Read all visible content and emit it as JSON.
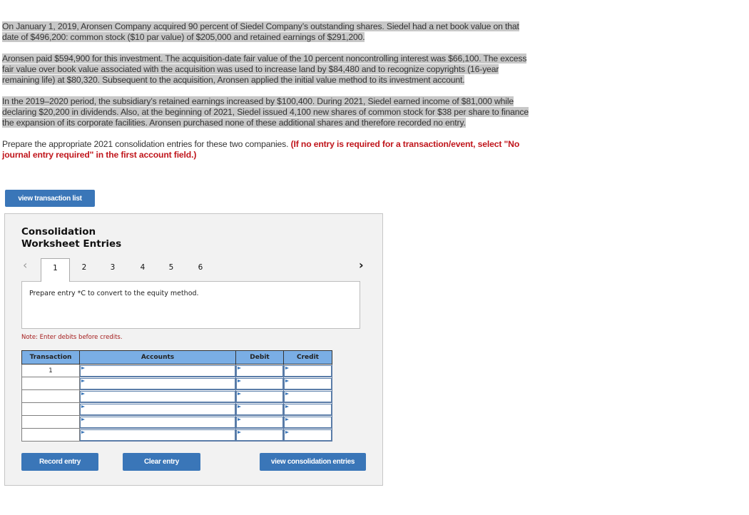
{
  "problem": {
    "paragraph1": "On January 1, 2019, Aronsen Company acquired 90 percent of Siedel Company’s outstanding shares. Siedel had a net book value on that date of $496,200: common stock ($10 par value) of $205,000 and retained earnings of $291,200.",
    "paragraph2": "Aronsen paid $594,900 for this investment. The acquisition-date fair value of the 10 percent noncontrolling interest was $66,100. The excess fair value over book value associated with the acquisition was used to increase land by $84,480 and to recognize copyrights (16-year remaining life) at $80,320. Subsequent to the acquisition, Aronsen applied the initial value method to its investment account.",
    "paragraph3": "In the 2019–2020 period, the subsidiary’s retained earnings increased by $100,400. During 2021, Siedel earned income of $81,000 while declaring $20,200 in dividends. Also, at the beginning of 2021, Siedel issued 4,100 new shares of common stock for $38 per share to finance the expansion of its corporate facilities. Aronsen purchased none of these additional shares and therefore recorded no entry.",
    "instruction": "Prepare the appropriate 2021 consolidation entries for these two companies.",
    "instruction_emphasis": "(If no entry is required for a transaction/event, select \"No journal entry required\" in the first account field.)"
  },
  "buttons": {
    "view_transaction_list": "view transaction list",
    "record_entry": "Record entry",
    "clear_entry": "Clear entry",
    "view_consolidation_entries": "view consolidation entries"
  },
  "worksheet": {
    "title_line1": "Consolidation",
    "title_line2": "Worksheet Entries",
    "prev_icon": "chevron-left-icon",
    "next_icon": "chevron-right-icon",
    "tabs": [
      "1",
      "2",
      "3",
      "4",
      "5",
      "6"
    ],
    "active_tab": "1",
    "entry_prompt": "Prepare entry *C to convert to the equity method.",
    "note": "Note: Enter debits before credits.",
    "table": {
      "headers": [
        "Transaction",
        "Accounts",
        "Debit",
        "Credit"
      ],
      "rows": [
        {
          "transaction": "1",
          "account": "",
          "debit": "",
          "credit": ""
        },
        {
          "transaction": "",
          "account": "",
          "debit": "",
          "credit": ""
        },
        {
          "transaction": "",
          "account": "",
          "debit": "",
          "credit": ""
        },
        {
          "transaction": "",
          "account": "",
          "debit": "",
          "credit": ""
        },
        {
          "transaction": "",
          "account": "",
          "debit": "",
          "credit": ""
        },
        {
          "transaction": "",
          "account": "",
          "debit": "",
          "credit": ""
        }
      ]
    }
  },
  "colors": {
    "button_blue": "#3a76b8",
    "header_blue": "#7aaee5",
    "emphasis_red": "#c0161c",
    "selection_gray": "#c8c8c8"
  }
}
